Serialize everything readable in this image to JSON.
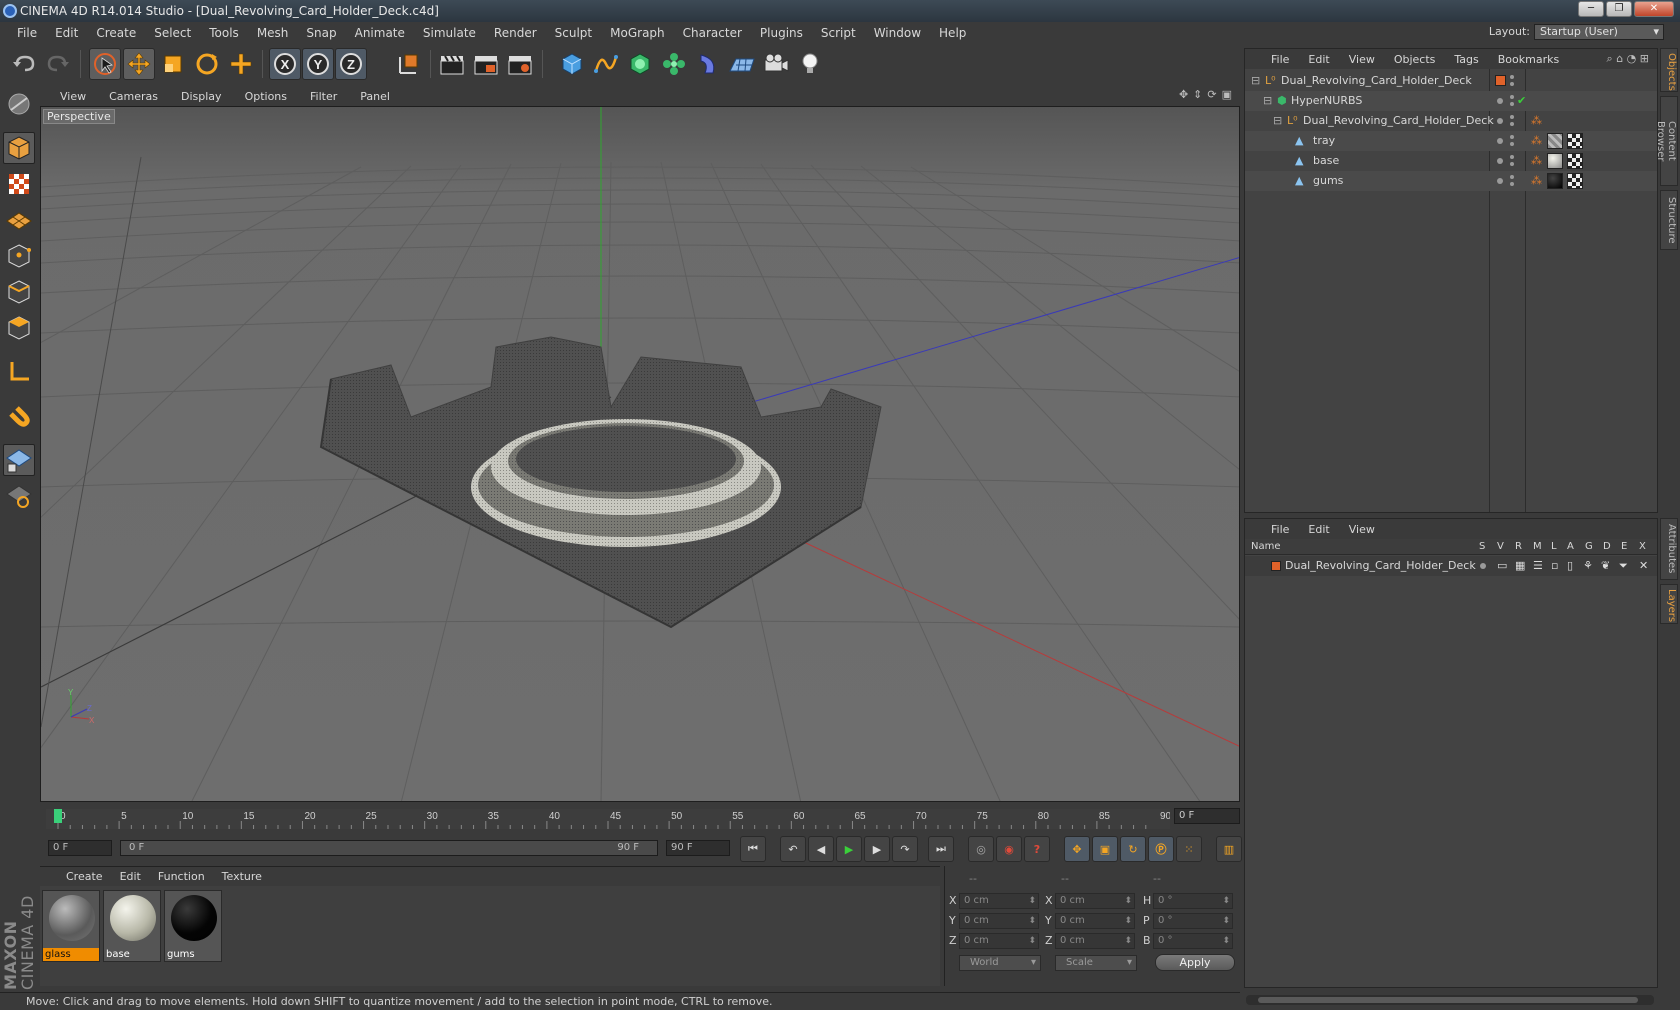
{
  "window": {
    "title": "CINEMA 4D R14.014 Studio - [Dual_Revolving_Card_Holder_Deck.c4d]"
  },
  "menubar": [
    "File",
    "Edit",
    "Create",
    "Select",
    "Tools",
    "Mesh",
    "Snap",
    "Animate",
    "Simulate",
    "Render",
    "Sculpt",
    "MoGraph",
    "Character",
    "Plugins",
    "Script",
    "Window",
    "Help"
  ],
  "layout": {
    "label": "Layout:",
    "value": "Startup (User)"
  },
  "viewport": {
    "menu": [
      "View",
      "Cameras",
      "Display",
      "Options",
      "Filter",
      "Panel"
    ],
    "label": "Perspective",
    "axis": {
      "x": "X",
      "y": "Y",
      "z": "Z"
    }
  },
  "timeline": {
    "ticks": [
      "0",
      "5",
      "10",
      "15",
      "20",
      "25",
      "30",
      "35",
      "40",
      "45",
      "50",
      "55",
      "60",
      "65",
      "70",
      "75",
      "80",
      "85",
      "90"
    ],
    "frame_display": "0 F",
    "start_field": "0 F",
    "range_start": "0 F",
    "range_end": "90 F",
    "end_field": "90 F"
  },
  "materials": {
    "menu": [
      "Create",
      "Edit",
      "Function",
      "Texture"
    ],
    "items": [
      {
        "name": "glass",
        "selected": true
      },
      {
        "name": "base",
        "selected": false
      },
      {
        "name": "gums",
        "selected": false
      }
    ]
  },
  "coords": {
    "headers": [
      "--",
      "--",
      "--"
    ],
    "rows": [
      {
        "a": "X",
        "av": "0 cm",
        "b": "X",
        "bv": "0 cm",
        "c": "H",
        "cv": "0 °"
      },
      {
        "a": "Y",
        "av": "0 cm",
        "b": "Y",
        "bv": "0 cm",
        "c": "P",
        "cv": "0 °"
      },
      {
        "a": "Z",
        "av": "0 cm",
        "b": "Z",
        "bv": "0 cm",
        "c": "B",
        "cv": "0 °"
      }
    ],
    "mode": "World",
    "scale": "Scale",
    "apply": "Apply"
  },
  "status": "Move: Click and drag to move elements. Hold down SHIFT to quantize movement / add to the selection in point mode, CTRL to remove.",
  "object_manager": {
    "menu": [
      "File",
      "Edit",
      "View",
      "Objects",
      "Tags",
      "Bookmarks"
    ],
    "objects": [
      {
        "name": "Dual_Revolving_Card_Holder_Deck",
        "level": 0
      },
      {
        "name": "HyperNURBS",
        "level": 1
      },
      {
        "name": "Dual_Revolving_Card_Holder_Deck",
        "level": 2
      },
      {
        "name": "tray",
        "level": 3
      },
      {
        "name": "base",
        "level": 3
      },
      {
        "name": "gums",
        "level": 3
      }
    ]
  },
  "layer_manager": {
    "menu": [
      "File",
      "Edit",
      "View"
    ],
    "columns": [
      "Name",
      "S",
      "V",
      "R",
      "M",
      "L",
      "A",
      "G",
      "D",
      "E",
      "X"
    ],
    "layers": [
      {
        "name": "Dual_Revolving_Card_Holder_Deck"
      }
    ]
  },
  "side_tabs": [
    "Objects",
    "Content Browser",
    "Structure",
    "Attributes",
    "Layers"
  ],
  "colors": {
    "accent": "#f08c00",
    "layer_color": "#e0622a",
    "viewport_bg": "#6c6c6c"
  },
  "brand": {
    "line1": "MAXON",
    "line2": "CINEMA 4D"
  }
}
